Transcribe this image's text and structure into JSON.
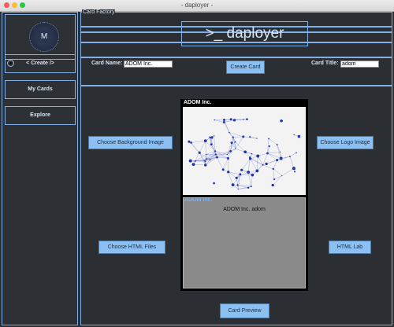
{
  "window": {
    "title": "- daployer -"
  },
  "sidebar": {
    "avatar_letter": "M",
    "items": [
      {
        "label": "< Create />"
      },
      {
        "label": "My Cards"
      },
      {
        "label": "Explore"
      }
    ]
  },
  "main": {
    "group_label": "Card Factory",
    "logo": ">_ daployer",
    "card_name": {
      "label": "Card Name:",
      "value": "ADOM Inc."
    },
    "card_title": {
      "label": "Card Title:",
      "value": "adom"
    },
    "create_button": "Create Card",
    "choose_background_button": "Choose Background Image",
    "choose_logo_button": "Choose Logo Image",
    "choose_html_button": "Choose HTML Files",
    "html_lab_button": "HTML Lab",
    "preview_button": "Card Preview",
    "preview": {
      "header": "ADOM Inc.",
      "body_label": "ADOM Inc.",
      "body_text": "ADOM Inc.  adom"
    }
  },
  "colors": {
    "accent": "#7fb0e6",
    "button": "#8cc0f2",
    "background": "#2b2e33"
  }
}
